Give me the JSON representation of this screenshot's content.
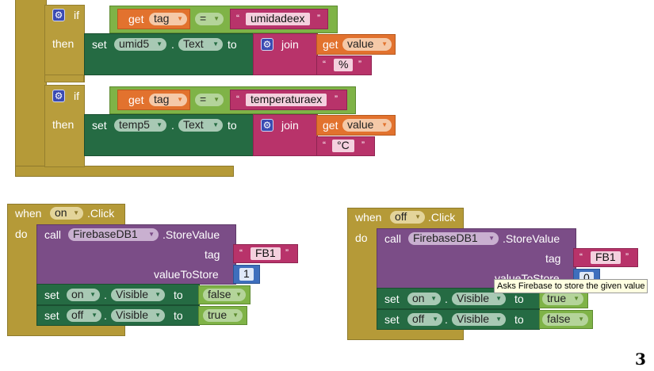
{
  "block1": {
    "if1": {
      "if_label": "if",
      "then_label": "then",
      "get_label": "get",
      "get_var": "tag",
      "op": "=",
      "compare_text": "umidadeex",
      "set_label": "set",
      "set_component": "umid5",
      "dot": ".",
      "set_property": "Text",
      "to_label": "to",
      "join_label": "join",
      "join_get_label": "get",
      "join_get_var": "value",
      "join_text": "%"
    },
    "if2": {
      "if_label": "if",
      "then_label": "then",
      "get_label": "get",
      "get_var": "tag",
      "op": "=",
      "compare_text": "temperaturaex",
      "set_label": "set",
      "set_component": "temp5",
      "dot": ".",
      "set_property": "Text",
      "to_label": "to",
      "join_label": "join",
      "join_get_label": "get",
      "join_get_var": "value",
      "join_text": "°C"
    }
  },
  "block_on": {
    "when_label": "when",
    "component": "on",
    "event": ".Click",
    "do_label": "do",
    "call_label": "call",
    "call_component": "FirebaseDB1",
    "method": ".StoreValue",
    "tag_label": "tag",
    "tag_value": "FB1",
    "value_label": "valueToStore",
    "value": "1",
    "set1": {
      "set_label": "set",
      "component": "on",
      "dot": ".",
      "property": "Visible",
      "to_label": "to",
      "value": "false"
    },
    "set2": {
      "set_label": "set",
      "component": "off",
      "dot": ".",
      "property": "Visible",
      "to_label": "to",
      "value": "true"
    }
  },
  "block_off": {
    "when_label": "when",
    "component": "off",
    "event": ".Click",
    "do_label": "do",
    "call_label": "call",
    "call_component": "FirebaseDB1",
    "method": ".StoreValue",
    "tag_label": "tag",
    "tag_value": "FB1",
    "value_label": "valueToStore",
    "value": "0",
    "set1": {
      "set_label": "set",
      "component": "on",
      "dot": ".",
      "property": "Visible",
      "to_label": "to",
      "value": "true"
    },
    "set2": {
      "set_label": "set",
      "component": "off",
      "dot": ".",
      "property": "Visible",
      "to_label": "to",
      "value": "false"
    }
  },
  "tooltip": "Asks Firebase to store the given value",
  "page_number": "3",
  "quote_mark_open": "“",
  "quote_mark_close": "”",
  "icons": {
    "mutator": "gear-icon",
    "dropdown": "triangle-down-icon"
  },
  "colors": {
    "control": "#b59a38",
    "logic": "#7fb347",
    "variable": "#e2722e",
    "text": "#b8336a",
    "component_setter": "#256b43",
    "component_method": "#7b4d87",
    "math": "#3e6fbd"
  }
}
